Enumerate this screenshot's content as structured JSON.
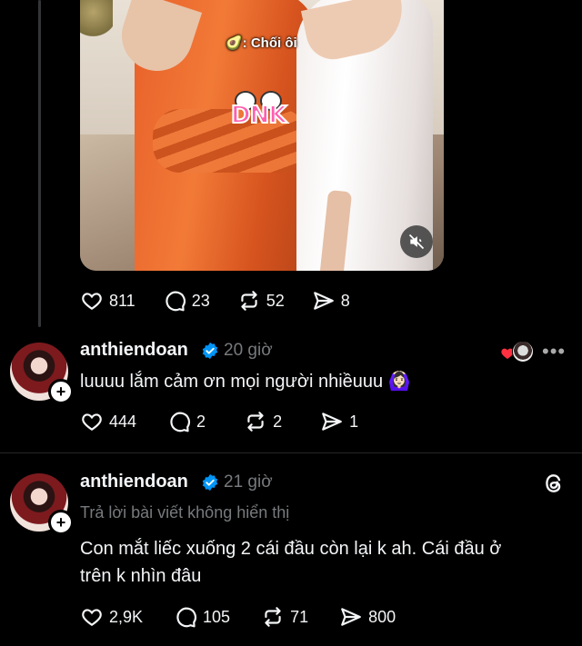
{
  "media": {
    "caption": "🥑: Chối ôi",
    "sticker_text": "DNK",
    "mute_icon": "speaker-muted-icon"
  },
  "post_actions": {
    "likes": "811",
    "replies": "23",
    "reposts": "52",
    "shares": "8"
  },
  "comments": [
    {
      "username": "anthiendoan",
      "time": "20 giờ",
      "text": "luuuu lắm cảm ơn mọi người nhiềuuu 🙆🏻‍♀️",
      "likes": "444",
      "replies": "2",
      "reposts": "2",
      "shares": "1",
      "more_label": "•••"
    },
    {
      "username": "anthiendoan",
      "time": "21 giờ",
      "reply_context": "Trả lời bài viết không hiển thị",
      "text_line1": "Con mắt liếc xuống 2 cái đầu còn lại k ah. Cái đầu ở",
      "text_line2": "trên k nhìn đâu",
      "likes": "2,9K",
      "replies": "105",
      "reposts": "71",
      "shares": "800"
    }
  ],
  "colors": {
    "background": "#000000",
    "text": "#f3f5f7",
    "muted": "#777a7d",
    "verified": "#0095f6",
    "heart_red": "#ff3040"
  }
}
